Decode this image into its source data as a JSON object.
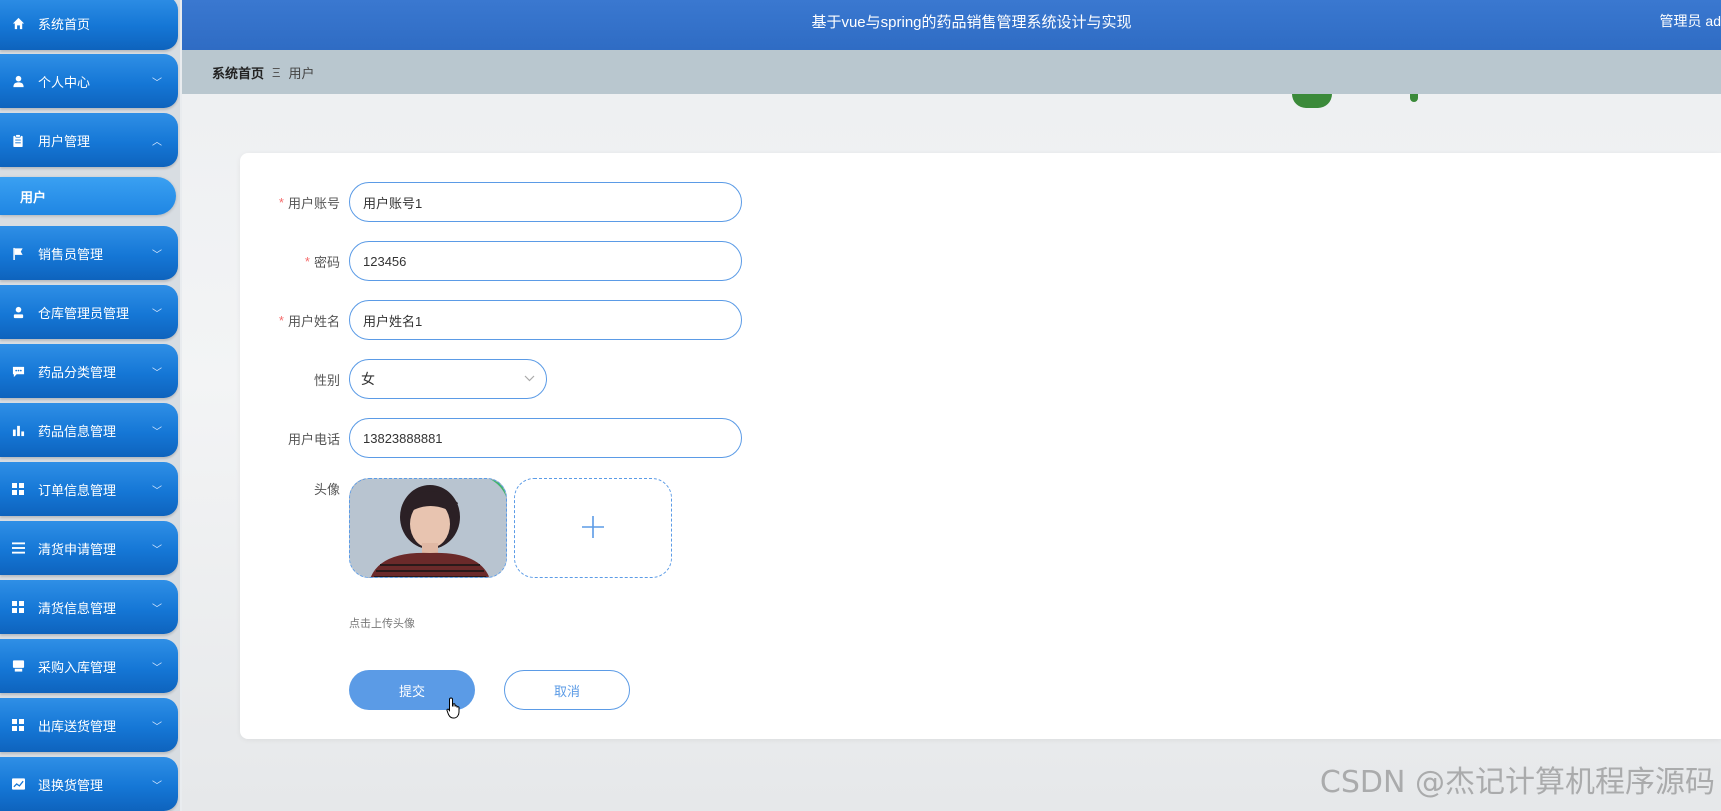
{
  "header": {
    "title": "基于vue与spring的药品销售管理系统设计与实现",
    "user": "管理员 ad"
  },
  "sidebar": {
    "items": [
      {
        "label": "系统首页",
        "icon": "home-icon",
        "chevron": ""
      },
      {
        "label": "个人中心",
        "icon": "user-icon",
        "chevron": "﹀"
      },
      {
        "label": "用户管理",
        "icon": "clipboard-icon",
        "chevron": "︿"
      },
      {
        "label": "销售员管理",
        "icon": "flag-icon",
        "chevron": "﹀"
      },
      {
        "label": "仓库管理员管理",
        "icon": "person-icon",
        "chevron": "﹀"
      },
      {
        "label": "药品分类管理",
        "icon": "chat-icon",
        "chevron": "﹀"
      },
      {
        "label": "药品信息管理",
        "icon": "bar-chart-icon",
        "chevron": "﹀"
      },
      {
        "label": "订单信息管理",
        "icon": "grid-icon",
        "chevron": "﹀"
      },
      {
        "label": "清货申请管理",
        "icon": "list-icon",
        "chevron": "﹀"
      },
      {
        "label": "清货信息管理",
        "icon": "grid-icon",
        "chevron": "﹀"
      },
      {
        "label": "采购入库管理",
        "icon": "inbox-icon",
        "chevron": "﹀"
      },
      {
        "label": "出库送货管理",
        "icon": "grid-icon",
        "chevron": "﹀"
      },
      {
        "label": "退换货管理",
        "icon": "trend-icon",
        "chevron": "﹀"
      }
    ],
    "sub_item": "用户"
  },
  "breadcrumb": {
    "home": "系统首页",
    "separator": "Ξ",
    "current": "用户"
  },
  "form": {
    "account_label": "用户账号",
    "account_value": "用户账号1",
    "password_label": "密码",
    "password_value": "123456",
    "name_label": "用户姓名",
    "name_value": "用户姓名1",
    "gender_label": "性别",
    "gender_value": "女",
    "phone_label": "用户电话",
    "phone_value": "13823888881",
    "avatar_label": "头像",
    "required_mark": "*",
    "upload_plus": "+",
    "upload_hint": "点击上传头像",
    "submit_label": "提交",
    "cancel_label": "取消"
  },
  "watermark": "CSDN @杰记计算机程序源码",
  "colors": {
    "primary": "#5b9be6",
    "header": "#2f6cc4",
    "sidebar": "#1577d6",
    "required": "#f56c6c"
  }
}
